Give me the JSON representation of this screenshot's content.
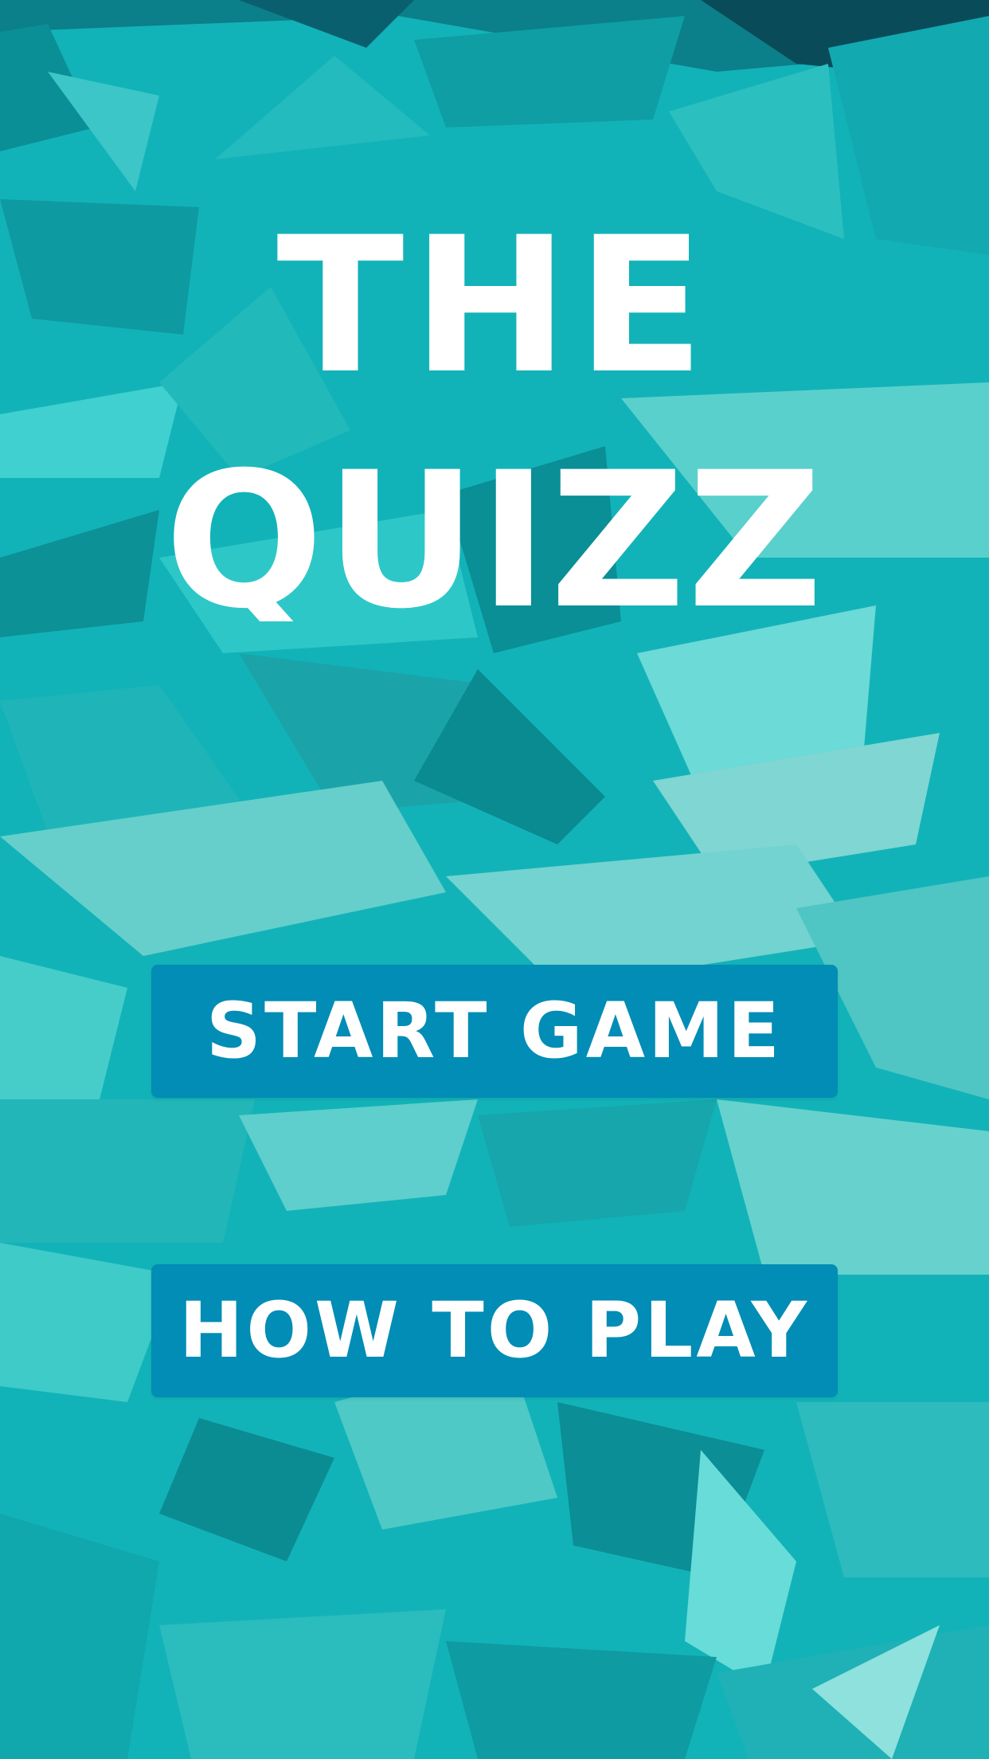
{
  "screen": {
    "title_line1": "THE",
    "title_line2": "QUIZZ"
  },
  "menu": {
    "start_label": "START GAME",
    "howto_label": "HOW TO PLAY"
  },
  "colors": {
    "background": "#12b3b8",
    "button": "#018db5",
    "text": "#ffffff"
  }
}
